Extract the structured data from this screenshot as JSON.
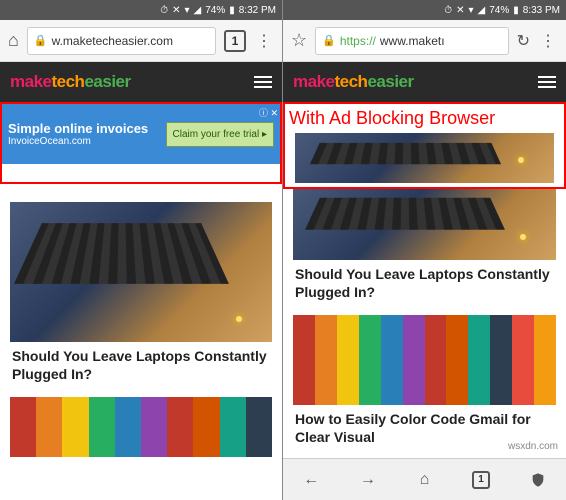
{
  "left": {
    "status": {
      "battery": "74%",
      "time": "8:32 PM"
    },
    "url": "w.maketecheasier.com",
    "tabs": "1",
    "logo": {
      "part1": "make",
      "part2": "tech",
      "part3": "easier"
    },
    "ad": {
      "headline": "Simple online invoices",
      "sub": "InvoiceOcean.com",
      "cta": "Claim your free trial ▸",
      "close": "ⓘ ✕"
    },
    "article1_title": "Should You Leave Laptops Constantly Plugged In?"
  },
  "right": {
    "status": {
      "battery": "74%",
      "time": "8:33 PM"
    },
    "url_https": "https://",
    "url_rest": "www.maketı",
    "logo": {
      "part1": "make",
      "part2": "tech",
      "part3": "easier"
    },
    "overlay": "With Ad Blocking Browser",
    "article1_title": "Should You Leave Laptops Constantly Plugged In?",
    "article2_title": "How to Easily Color Code Gmail for Clear Visual",
    "tabs": "1"
  },
  "watermark": "wsxdn.com"
}
